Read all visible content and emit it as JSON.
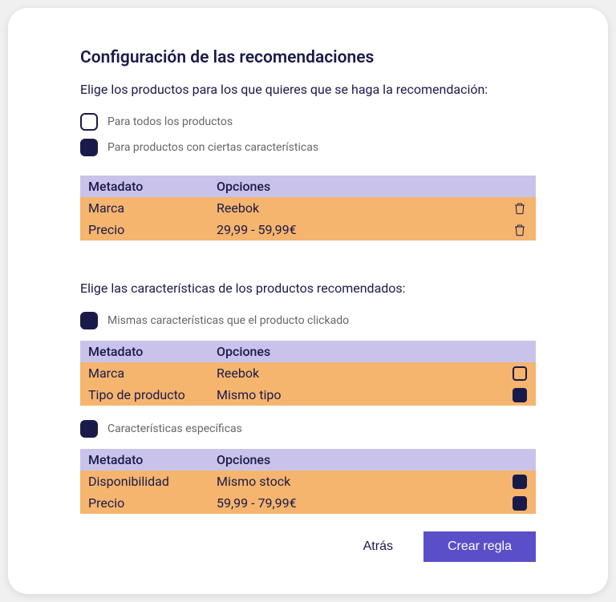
{
  "title": "Configuración de las recomendaciones",
  "section1": {
    "subtitle": "Elige los productos para los que quieres que se haga la recomendación:",
    "option_all": "Para todos los productos",
    "option_filtered": "Para productos con ciertas características",
    "table": {
      "header_metadata": "Metadato",
      "header_options": "Opciones",
      "rows": [
        {
          "metadata": "Marca",
          "options": "Reebok"
        },
        {
          "metadata": "Precio",
          "options": "29,99 - 59,99€"
        }
      ]
    }
  },
  "section2": {
    "subtitle": "Elige las características de los productos recomendados:",
    "option_same": "Mismas características que el producto clickado",
    "option_specific": "Características específicas",
    "table_same": {
      "header_metadata": "Metadato",
      "header_options": "Opciones",
      "rows": [
        {
          "metadata": "Marca",
          "options": "Reebok",
          "checked": false
        },
        {
          "metadata": "Tipo de producto",
          "options": "Mismo tipo",
          "checked": true
        }
      ]
    },
    "table_specific": {
      "header_metadata": "Metadato",
      "header_options": "Opciones",
      "rows": [
        {
          "metadata": "Disponibilidad",
          "options": "Mismo stock",
          "checked": true
        },
        {
          "metadata": "Precio",
          "options": "59,99 - 79,99€",
          "checked": true
        }
      ]
    }
  },
  "footer": {
    "back": "Atrás",
    "create": "Crear regla"
  }
}
